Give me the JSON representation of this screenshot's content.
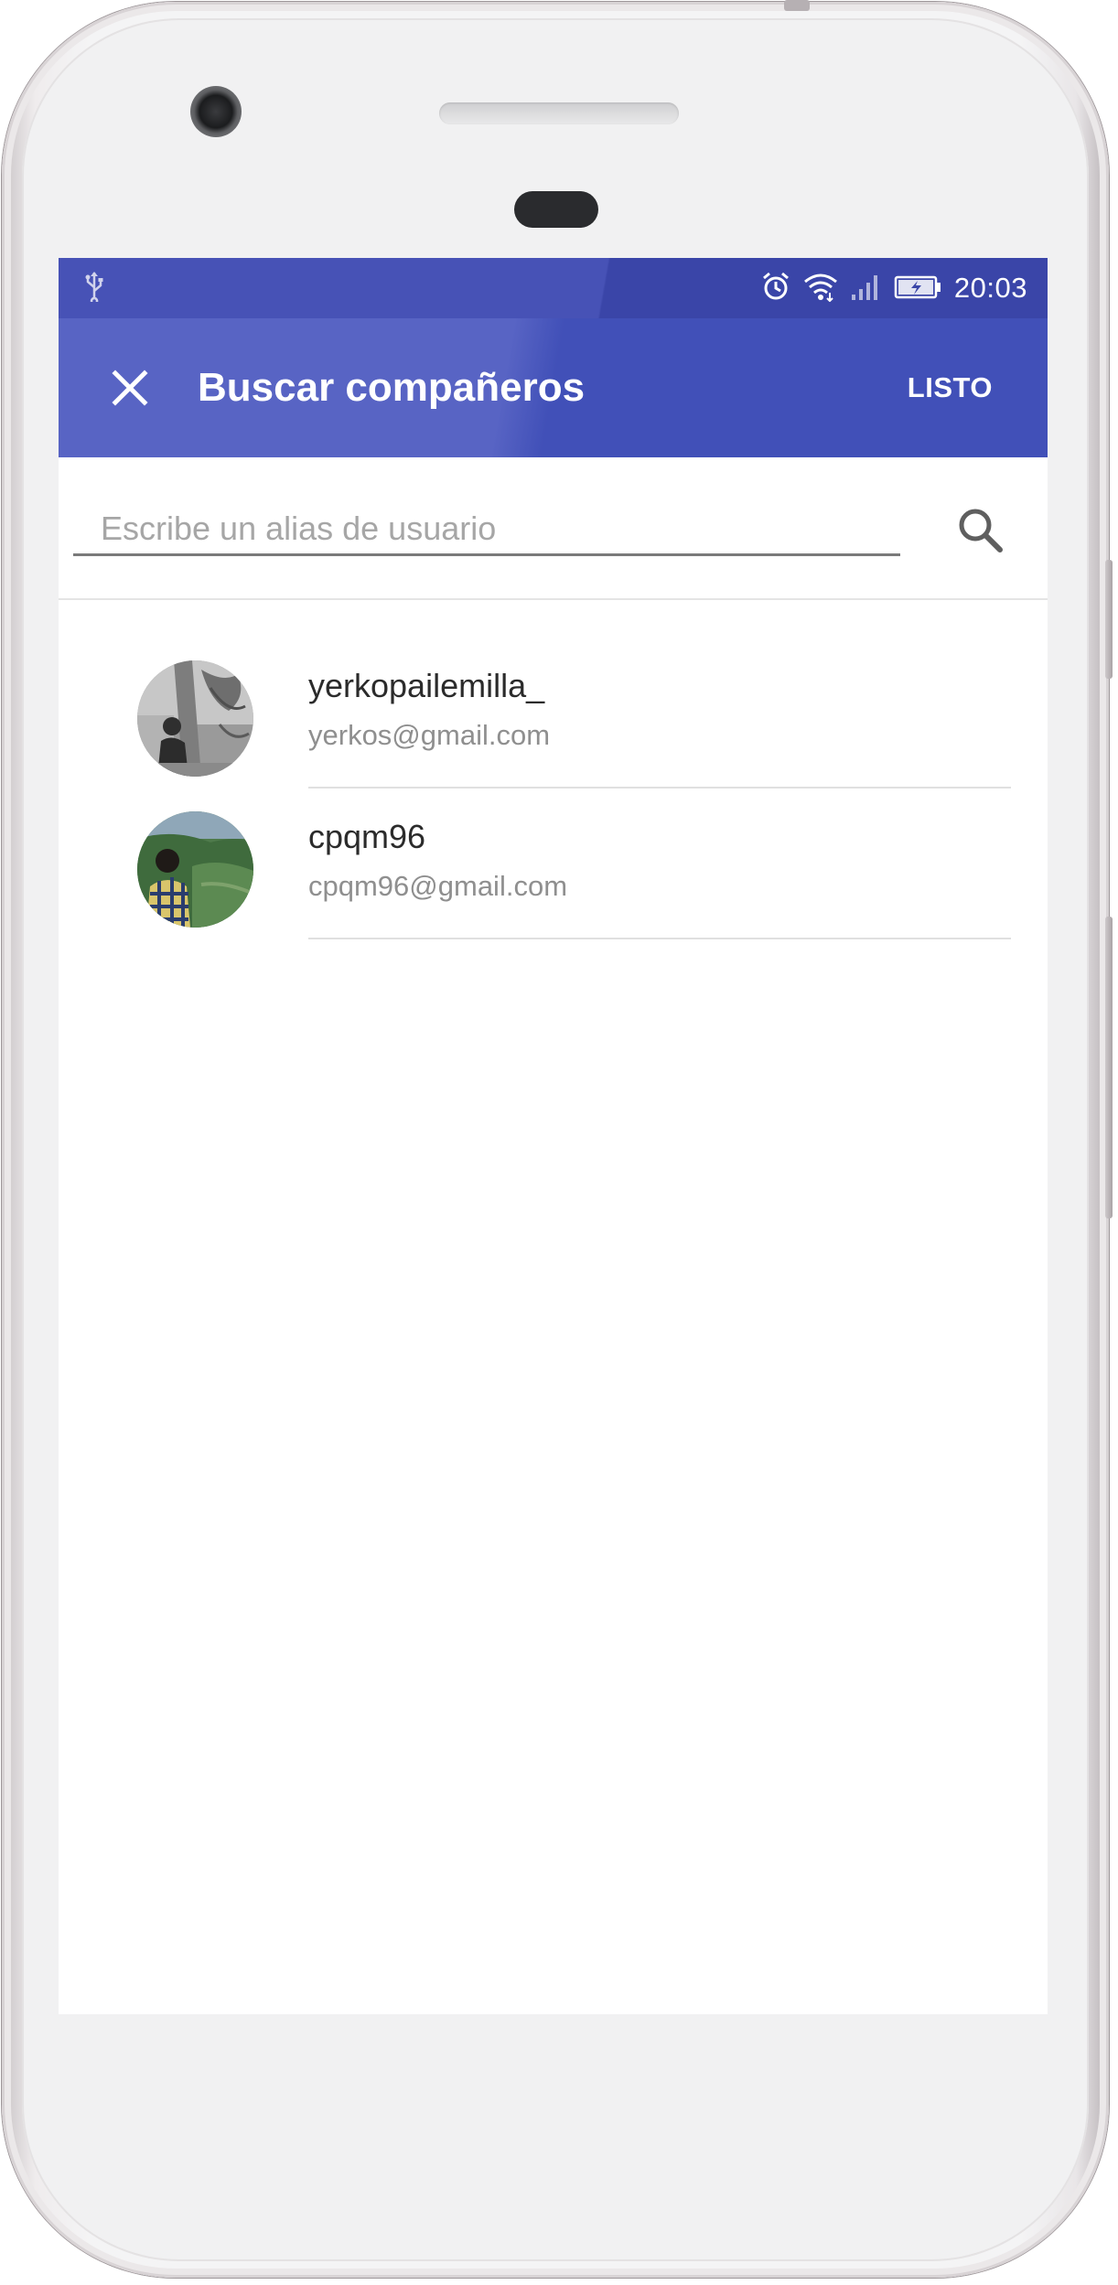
{
  "status_bar": {
    "time": "20:03",
    "icons": [
      "usb-icon",
      "alarm-icon",
      "wifi-icon",
      "signal-icon",
      "battery-charging-icon"
    ]
  },
  "app_bar": {
    "title": "Buscar compañeros",
    "close_icon": "close-icon",
    "done_label": "LISTO"
  },
  "search": {
    "placeholder": "Escribe un alias de usuario",
    "value": "",
    "icon": "search-icon"
  },
  "results": [
    {
      "username": "yerkopailemilla_",
      "email": "yerkos@gmail.com",
      "avatar": "grayscale-photo-avatar"
    },
    {
      "username": "cpqm96",
      "email": "cpqm96@gmail.com",
      "avatar": "landscape-photo-avatar"
    }
  ],
  "colors": {
    "primary": "#4150b8",
    "primary_light": "#5864c4",
    "status_bar": "#3a45a8",
    "text_primary": "#2b2b2b",
    "text_secondary": "#8f8f8f",
    "divider": "#e0e0e0"
  }
}
